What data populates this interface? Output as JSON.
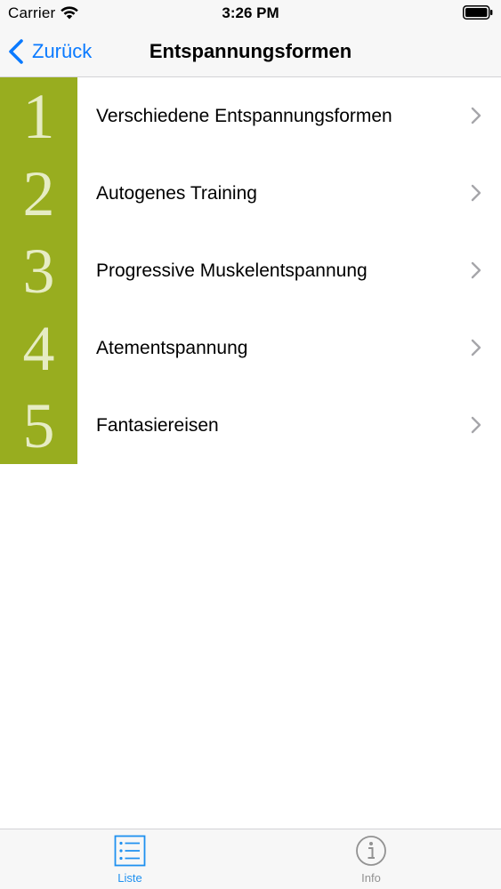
{
  "status_bar": {
    "carrier": "Carrier",
    "time": "3:26 PM"
  },
  "nav": {
    "back_label": "Zurück",
    "title": "Entspannungsformen"
  },
  "list": {
    "accent_color": "#98ad1f",
    "items": [
      {
        "number": "1",
        "label": "Verschiedene Entspannungsformen"
      },
      {
        "number": "2",
        "label": "Autogenes Training"
      },
      {
        "number": "3",
        "label": "Progressive Muskelentspannung"
      },
      {
        "number": "4",
        "label": "Atementspannung"
      },
      {
        "number": "5",
        "label": "Fantasiereisen"
      }
    ]
  },
  "tab_bar": {
    "tabs": [
      {
        "label": "Liste",
        "icon": "list-icon",
        "selected": true
      },
      {
        "label": "Info",
        "icon": "info-icon",
        "selected": false
      }
    ]
  },
  "colors": {
    "tint": "#0a7aff",
    "selected_tab": "#1e90f0",
    "unselected_tab": "#929292"
  }
}
